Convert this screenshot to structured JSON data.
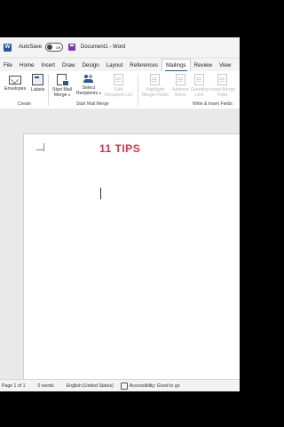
{
  "titlebar": {
    "app_icon": "W",
    "autosave_label": "AutoSave",
    "autosave_state": "Off",
    "document_name": "Document1 - Word"
  },
  "tabs": [
    {
      "label": "File",
      "active": false
    },
    {
      "label": "Home",
      "active": false
    },
    {
      "label": "Insert",
      "active": false
    },
    {
      "label": "Draw",
      "active": false
    },
    {
      "label": "Design",
      "active": false
    },
    {
      "label": "Layout",
      "active": false
    },
    {
      "label": "References",
      "active": false
    },
    {
      "label": "Mailings",
      "active": true
    },
    {
      "label": "Review",
      "active": false
    },
    {
      "label": "View",
      "active": false
    }
  ],
  "ribbon": {
    "create": {
      "group_label": "Create",
      "envelopes": "Envelopes",
      "labels": "Labels"
    },
    "start_mail_merge": {
      "group_label": "Start Mail Merge",
      "start_line1": "Start Mail",
      "start_line2": "Merge",
      "select_line1": "Select",
      "select_line2": "Recipients",
      "edit_line1": "Edit",
      "edit_line2": "Recipient List"
    },
    "write_insert": {
      "group_label": "Write & Insert Fields",
      "highlight_line1": "Highlight",
      "highlight_line2": "Merge Fields",
      "address_line1": "Address",
      "address_line2": "Block",
      "greeting_line1": "Greeting",
      "greeting_line2": "Line",
      "insert_line1": "Insert Merge",
      "insert_line2": "Field"
    }
  },
  "document": {
    "overlay_caption": "11 TIPS"
  },
  "statusbar": {
    "page": "Page 1 of 1",
    "words": "0 words",
    "language": "English (United States)",
    "accessibility": "Accessibility: Good to go"
  },
  "colors": {
    "accent": "#2b579a",
    "caption": "#d9334a"
  }
}
